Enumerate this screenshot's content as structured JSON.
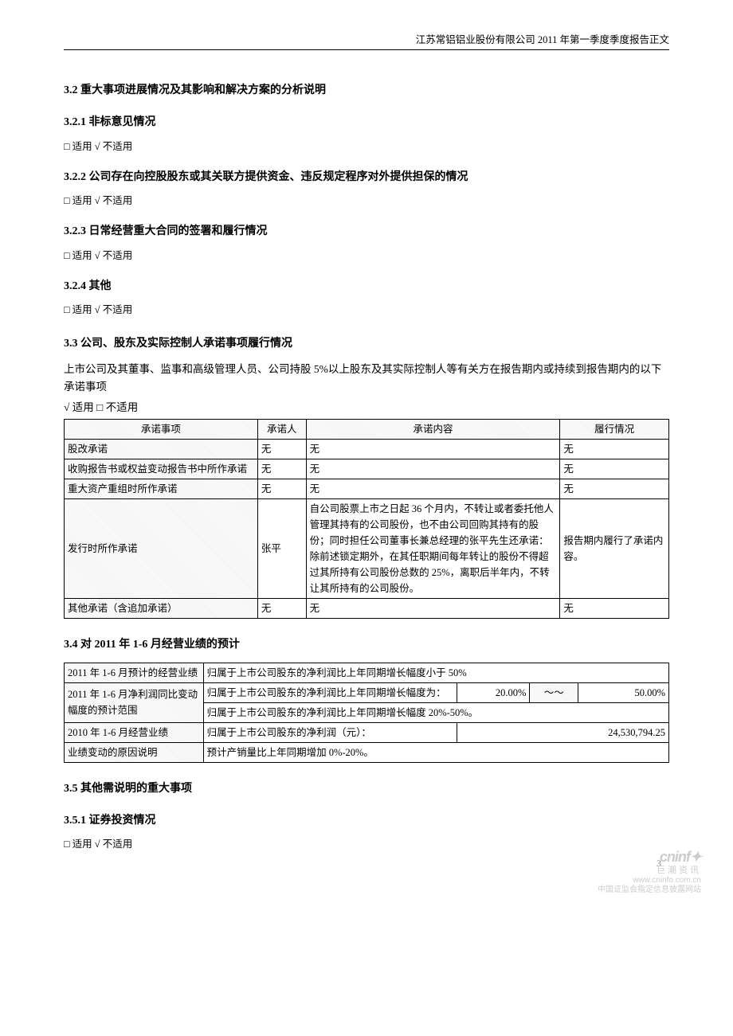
{
  "header": {
    "company_report": "江苏常铝铝业股份有限公司 2011 年第一季度季度报告正文"
  },
  "s32": {
    "title": "3.2 重大事项进展情况及其影响和解决方案的分析说明",
    "s321": {
      "title": "3.2.1 非标意见情况",
      "applicable": "□ 适用 √ 不适用"
    },
    "s322": {
      "title": "3.2.2 公司存在向控股股东或其关联方提供资金、违反规定程序对外提供担保的情况",
      "applicable": "□ 适用 √ 不适用"
    },
    "s323": {
      "title": "3.2.3 日常经营重大合同的签署和履行情况",
      "applicable": "□ 适用 √ 不适用"
    },
    "s324": {
      "title": "3.2.4 其他",
      "applicable": "□ 适用 √ 不适用"
    }
  },
  "s33": {
    "title": "3.3 公司、股东及实际控制人承诺事项履行情况",
    "intro": "上市公司及其董事、监事和高级管理人员、公司持股 5%以上股东及其实际控制人等有关方在报告期内或持续到报告期内的以下承诺事项",
    "applicable": "√ 适用 □ 不适用",
    "headers": {
      "h1": "承诺事项",
      "h2": "承诺人",
      "h3": "承诺内容",
      "h4": "履行情况"
    },
    "rows": [
      {
        "c1": "股改承诺",
        "c2": "无",
        "c3": "无",
        "c4": "无"
      },
      {
        "c1": "收购报告书或权益变动报告书中所作承诺",
        "c2": "无",
        "c3": "无",
        "c4": "无"
      },
      {
        "c1": "重大资产重组时所作承诺",
        "c2": "无",
        "c3": "无",
        "c4": "无"
      },
      {
        "c1": "发行时所作承诺",
        "c2": "张平",
        "c3": "自公司股票上市之日起 36 个月内，不转让或者委托他人管理其持有的公司股份，也不由公司回购其持有的股份；同时担任公司董事长兼总经理的张平先生还承诺：除前述锁定期外，在其任职期间每年转让的股份不得超过其所持有公司股份总数的 25%，离职后半年内，不转让其所持有的公司股份。",
        "c4": "报告期内履行了承诺内容。"
      },
      {
        "c1": "其他承诺（含追加承诺）",
        "c2": "无",
        "c3": "无",
        "c4": "无"
      }
    ]
  },
  "s34": {
    "title": "3.4 对 2011 年 1-6 月经营业绩的预计",
    "r1_label": "2011 年 1-6 月预计的经营业绩",
    "r1_value": "归属于上市公司股东的净利润比上年同期增长幅度小于 50%",
    "r2_rowlabel": "2011 年 1-6 月净利润同比变动幅度的预计范围",
    "r2_desc": "归属于上市公司股东的净利润比上年同期增长幅度",
    "r2_desc_suffix": "为：",
    "r2_low": "20.00%",
    "r2_tilde": "～～",
    "r2_high": "50.00%",
    "r2_range_text": "归属于上市公司股东的净利润比上年同期增长幅度 20%-50%。",
    "r3_label": "2010 年 1-6 月经营业绩",
    "r3_desc": "归属于上市公司股东的净利润（元）：",
    "r3_value": "24,530,794.25",
    "r4_label": "业绩变动的原因说明",
    "r4_value": "预计产销量比上年同期增加 0%-20%。"
  },
  "s35": {
    "title": "3.5 其他需说明的重大事项",
    "s351": {
      "title": "3.5.1 证券投资情况",
      "applicable": "□ 适用 √ 不适用"
    }
  },
  "footer": {
    "page": "3",
    "logo1": "cninf",
    "logo2": "巨潮资讯",
    "url": "www.cninfo.com.cn",
    "tagline": "中国证监会指定信息披露网站"
  }
}
